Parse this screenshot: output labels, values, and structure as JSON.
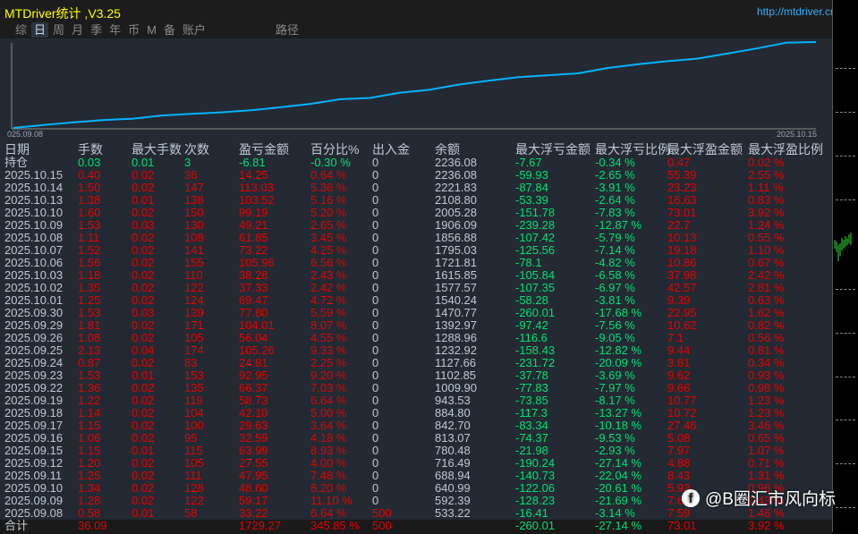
{
  "app": {
    "title": "MTDriver统计 ,V3.25",
    "link": "http://mtdriver.cn"
  },
  "tabs": [
    {
      "label": "综"
    },
    {
      "label": "日",
      "active": true
    },
    {
      "label": "周"
    },
    {
      "label": "月"
    },
    {
      "label": "季"
    },
    {
      "label": "年"
    },
    {
      "label": "币"
    },
    {
      "label": "M"
    },
    {
      "label": "备"
    },
    {
      "label": "账户"
    },
    {
      "label": "路径"
    }
  ],
  "chart": {
    "start_label": "025.09.08",
    "end_label": "2025.10.15"
  },
  "columns": [
    "日期",
    "手数",
    "最大手数",
    "次数",
    "盈亏金额",
    "百分比%",
    "出入金",
    "余额",
    "最大浮亏金额",
    "最大浮亏比例",
    "最大浮盈金额",
    "最大浮盈比例"
  ],
  "position_row": [
    "持仓",
    "0.03",
    "0.01",
    "3",
    "-6.81",
    "-0.30 %",
    "0",
    "2236.08",
    "-7.67",
    "-0.34 %",
    "0.47",
    "0.02 %"
  ],
  "rows": [
    [
      "2025.10.15",
      "0.40",
      "0.02",
      "36",
      "14.25",
      "0.64 %",
      "0",
      "2236.08",
      "-59.93",
      "-2.65 %",
      "55.39",
      "2.55 %"
    ],
    [
      "2025.10.14",
      "1.50",
      "0.02",
      "147",
      "113.03",
      "5.36 %",
      "0",
      "2221.83",
      "-87.84",
      "-3.91 %",
      "23.23",
      "1.11 %"
    ],
    [
      "2025.10.13",
      "1.38",
      "0.01",
      "138",
      "103.52",
      "5.16 %",
      "0",
      "2108.80",
      "-53.39",
      "-2.64 %",
      "16.63",
      "0.83 %"
    ],
    [
      "2025.10.10",
      "1.60",
      "0.02",
      "150",
      "99.19",
      "5.20 %",
      "0",
      "2005.28",
      "-151.78",
      "-7.83 %",
      "73.01",
      "3.92 %"
    ],
    [
      "2025.10.09",
      "1.53",
      "0.03",
      "130",
      "49.21",
      "2.65 %",
      "0",
      "1906.09",
      "-239.28",
      "-12.87 %",
      "22.7",
      "1.24 %"
    ],
    [
      "2025.10.08",
      "1.11",
      "0.02",
      "108",
      "61.85",
      "3.45 %",
      "0",
      "1856.88",
      "-107.42",
      "-5.79 %",
      "10.13",
      "0.55 %"
    ],
    [
      "2025.10.07",
      "1.52",
      "0.02",
      "141",
      "73.22",
      "4.25 %",
      "0",
      "1795.03",
      "-125.56",
      "-7.14 %",
      "19.18",
      "1.10 %"
    ],
    [
      "2025.10.06",
      "1.56",
      "0.02",
      "155",
      "105.96",
      "6.56 %",
      "0",
      "1721.81",
      "-78.1",
      "-4.82 %",
      "10.86",
      "0.67 %"
    ],
    [
      "2025.10.03",
      "1.18",
      "0.02",
      "110",
      "38.28",
      "2.43 %",
      "0",
      "1615.85",
      "-105.84",
      "-6.58 %",
      "37.98",
      "2.42 %"
    ],
    [
      "2025.10.02",
      "1.35",
      "0.02",
      "122",
      "37.33",
      "2.42 %",
      "0",
      "1577.57",
      "-107.35",
      "-6.97 %",
      "42.57",
      "2.81 %"
    ],
    [
      "2025.10.01",
      "1.25",
      "0.02",
      "124",
      "69.47",
      "4.72 %",
      "0",
      "1540.24",
      "-58.28",
      "-3.81 %",
      "9.39",
      "0.63 %"
    ],
    [
      "2025.09.30",
      "1.53",
      "0.03",
      "139",
      "77.80",
      "5.59 %",
      "0",
      "1470.77",
      "-260.01",
      "-17.68 %",
      "22.95",
      "1.62 %"
    ],
    [
      "2025.09.29",
      "1.81",
      "0.02",
      "171",
      "104.01",
      "8.07 %",
      "0",
      "1392.97",
      "-97.42",
      "-7.56 %",
      "10.62",
      "0.82 %"
    ],
    [
      "2025.09.26",
      "1.08",
      "0.02",
      "105",
      "56.04",
      "4.55 %",
      "0",
      "1288.96",
      "-116.6",
      "-9.05 %",
      "7.1",
      "0.56 %"
    ],
    [
      "2025.09.25",
      "2.13",
      "0.04",
      "174",
      "105.26",
      "9.33 %",
      "0",
      "1232.92",
      "-158.43",
      "-12.82 %",
      "9.44",
      "0.81 %"
    ],
    [
      "2025.09.24",
      "0.87",
      "0.02",
      "83",
      "24.81",
      "2.25 %",
      "0",
      "1127.66",
      "-231.72",
      "-20.09 %",
      "3.81",
      "0.34 %"
    ],
    [
      "2025.09.23",
      "1.53",
      "0.01",
      "153",
      "92.95",
      "9.20 %",
      "0",
      "1102.85",
      "-37.78",
      "-3.69 %",
      "9.62",
      "0.93 %"
    ],
    [
      "2025.09.22",
      "1.36",
      "0.02",
      "135",
      "66.37",
      "7.03 %",
      "0",
      "1009.90",
      "-77.83",
      "-7.97 %",
      "9.66",
      "0.98 %"
    ],
    [
      "2025.09.19",
      "1.22",
      "0.02",
      "119",
      "58.73",
      "6.64 %",
      "0",
      "943.53",
      "-73.85",
      "-8.17 %",
      "10.77",
      "1.23 %"
    ],
    [
      "2025.09.18",
      "1.14",
      "0.02",
      "104",
      "42.10",
      "5.00 %",
      "0",
      "884.80",
      "-117.3",
      "-13.27 %",
      "10.72",
      "1.23 %"
    ],
    [
      "2025.09.17",
      "1.15",
      "0.02",
      "100",
      "29.63",
      "3.64 %",
      "0",
      "842.70",
      "-83.34",
      "-10.18 %",
      "27.46",
      "3.46 %"
    ],
    [
      "2025.09.16",
      "1.06",
      "0.02",
      "95",
      "32.59",
      "4.18 %",
      "0",
      "813.07",
      "-74.37",
      "-9.53 %",
      "5.08",
      "0.65 %"
    ],
    [
      "2025.09.15",
      "1.15",
      "0.01",
      "115",
      "63.99",
      "8.93 %",
      "0",
      "780.48",
      "-21.98",
      "-2.93 %",
      "7.97",
      "1.07 %"
    ],
    [
      "2025.09.12",
      "1.20",
      "0.02",
      "105",
      "27.55",
      "4.00 %",
      "0",
      "716.49",
      "-190.24",
      "-27.14 %",
      "4.88",
      "0.71 %"
    ],
    [
      "2025.09.11",
      "1.25",
      "0.02",
      "111",
      "47.95",
      "7.48 %",
      "0",
      "688.94",
      "-140.73",
      "-22.04 %",
      "8.43",
      "1.31 %"
    ],
    [
      "2025.09.10",
      "1.34",
      "0.02",
      "128",
      "48.60",
      "8.20 %",
      "0",
      "640.99",
      "-122.06",
      "-20.61 %",
      "5.93",
      "0.96 %"
    ],
    [
      "2025.09.09",
      "1.28",
      "0.02",
      "122",
      "59.17",
      "11.10 %",
      "0",
      "592.39",
      "-128.23",
      "-21.69 %",
      "7.65",
      "1.43 %"
    ],
    [
      "2025.09.08",
      "0.58",
      "0.01",
      "58",
      "33.22",
      "6.64 %",
      "500",
      "533.22",
      "-16.41",
      "-3.14 %",
      "7.59",
      "1.46 %"
    ]
  ],
  "total_row": [
    "合计",
    "36.09",
    "",
    "",
    "1729.27",
    "345.85 %",
    "500",
    "",
    "-260.01",
    "-27.14 %",
    "73.01",
    "3.92 %"
  ],
  "watermark": "@B圈汇市风向标",
  "colors": {
    "profit": "#e80000",
    "loss": "#00e070",
    "line": "#00b4ff",
    "title": "#ffff00"
  }
}
